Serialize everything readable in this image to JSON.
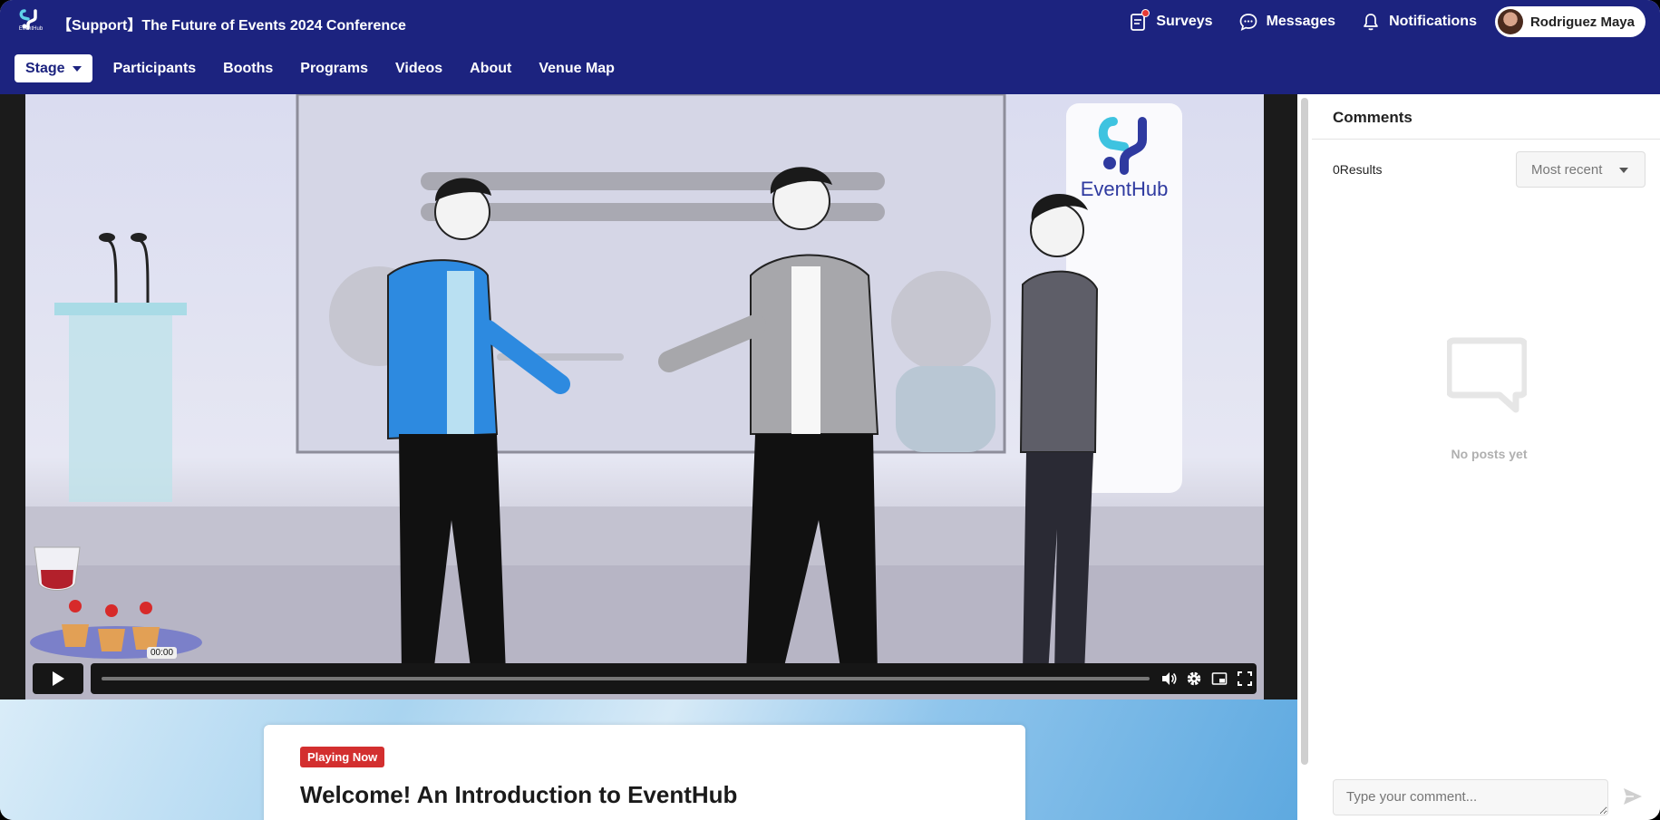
{
  "header": {
    "logo_text": "EventHub",
    "event_title": "【Support】The Future of Events 2024 Conference",
    "actions": {
      "surveys": "Surveys",
      "messages": "Messages",
      "notifications": "Notifications"
    },
    "user_name": "Rodriguez Maya"
  },
  "nav": {
    "stage": "Stage",
    "items": [
      "Participants",
      "Booths",
      "Programs",
      "Videos",
      "About",
      "Venue Map"
    ]
  },
  "video": {
    "brand_text": "EventHub",
    "current_time": "00:00",
    "progress": 0.0
  },
  "session": {
    "badge": "Playing Now",
    "title": "Welcome! An Introduction to EventHub"
  },
  "comments": {
    "title": "Comments",
    "results": "0Results",
    "sort": "Most recent",
    "empty": "No posts yet",
    "placeholder": "Type your comment..."
  },
  "colors": {
    "header_bg": "#1c237f",
    "badge_red": "#d32f2f"
  }
}
